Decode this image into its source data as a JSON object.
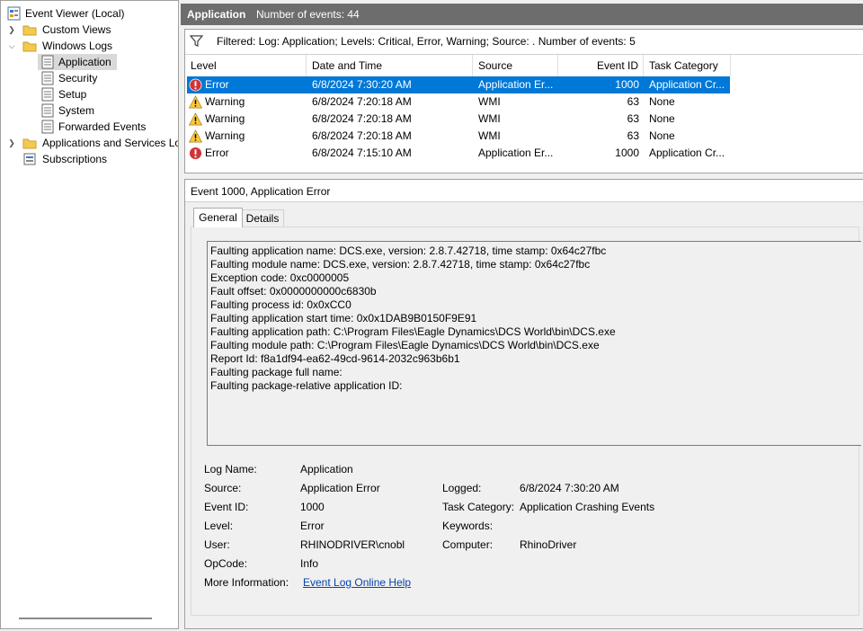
{
  "tree": {
    "root": "Event Viewer (Local)",
    "custom_views": "Custom Views",
    "windows_logs": "Windows Logs",
    "application": "Application",
    "security": "Security",
    "setup": "Setup",
    "system": "System",
    "forwarded_events": "Forwarded Events",
    "apps_services": "Applications and Services Lo",
    "subscriptions": "Subscriptions"
  },
  "header": {
    "title": "Application",
    "count": "Number of events: 44"
  },
  "filter": {
    "text": "Filtered: Log: Application; Levels: Critical, Error, Warning; Source: . Number of events: 5"
  },
  "columns": {
    "level": "Level",
    "date": "Date and Time",
    "source": "Source",
    "event_id": "Event ID",
    "task": "Task Category"
  },
  "events": [
    {
      "level": "Error",
      "date": "6/8/2024 7:30:20 AM",
      "source": "Application Er...",
      "event_id": "1000",
      "task": "Application Cr...",
      "icon": "error-icon"
    },
    {
      "level": "Warning",
      "date": "6/8/2024 7:20:18 AM",
      "source": "WMI",
      "event_id": "63",
      "task": "None",
      "icon": "warning-icon"
    },
    {
      "level": "Warning",
      "date": "6/8/2024 7:20:18 AM",
      "source": "WMI",
      "event_id": "63",
      "task": "None",
      "icon": "warning-icon"
    },
    {
      "level": "Warning",
      "date": "6/8/2024 7:20:18 AM",
      "source": "WMI",
      "event_id": "63",
      "task": "None",
      "icon": "warning-icon"
    },
    {
      "level": "Error",
      "date": "6/8/2024 7:15:10 AM",
      "source": "Application Er...",
      "event_id": "1000",
      "task": "Application Cr...",
      "icon": "error-icon"
    }
  ],
  "detail": {
    "title": "Event 1000, Application Error",
    "tabs": {
      "general": "General",
      "details": "Details"
    },
    "message": [
      "Faulting application name: DCS.exe, version: 2.8.7.42718, time stamp: 0x64c27fbc",
      "Faulting module name: DCS.exe, version: 2.8.7.42718, time stamp: 0x64c27fbc",
      "Exception code: 0xc0000005",
      "Fault offset: 0x0000000000c6830b",
      "Faulting process id: 0x0xCC0",
      "Faulting application start time: 0x0x1DAB9B0150F9E91",
      "Faulting application path: C:\\Program Files\\Eagle Dynamics\\DCS World\\bin\\DCS.exe",
      "Faulting module path: C:\\Program Files\\Eagle Dynamics\\DCS World\\bin\\DCS.exe",
      "Report Id: f8a1df94-ea62-49cd-9614-2032c963b6b1",
      "Faulting package full name: ",
      "Faulting package-relative application ID: "
    ],
    "fields": {
      "log_name_label": "Log Name:",
      "log_name": "Application",
      "source_label": "Source:",
      "source": "Application Error",
      "logged_label": "Logged:",
      "logged": "6/8/2024 7:30:20 AM",
      "event_id_label": "Event ID:",
      "event_id": "1000",
      "task_label": "Task Category:",
      "task": "Application Crashing Events",
      "level_label": "Level:",
      "level": "Error",
      "keywords_label": "Keywords:",
      "keywords": "",
      "user_label": "User:",
      "user": "RHINODRIVER\\cnobl",
      "computer_label": "Computer:",
      "computer": "RhinoDriver",
      "opcode_label": "OpCode:",
      "opcode": "Info",
      "more_info_label": "More Information:",
      "more_info_link": "Event Log Online Help"
    }
  },
  "colors": {
    "selection": "#0078d7",
    "header_bg": "#6d6d6d",
    "link": "#0645ad",
    "error": "#d13438",
    "warning": "#ffc83d"
  }
}
